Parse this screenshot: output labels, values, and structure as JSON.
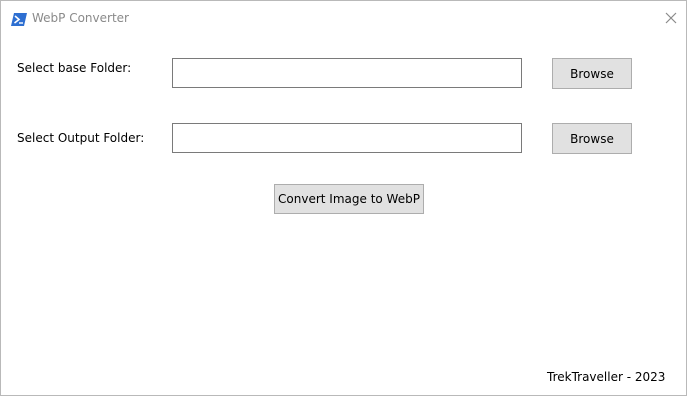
{
  "window": {
    "title": "WebP Converter",
    "icon": "powershell-icon"
  },
  "form": {
    "base_folder_label": "Select base Folder:",
    "base_folder_value": "",
    "base_browse_label": "Browse",
    "output_folder_label": "Select Output Folder:",
    "output_folder_value": "",
    "output_browse_label": "Browse",
    "convert_label": "Convert Image to WebP"
  },
  "footer": {
    "credit": "TrekTraveller - 2023"
  }
}
